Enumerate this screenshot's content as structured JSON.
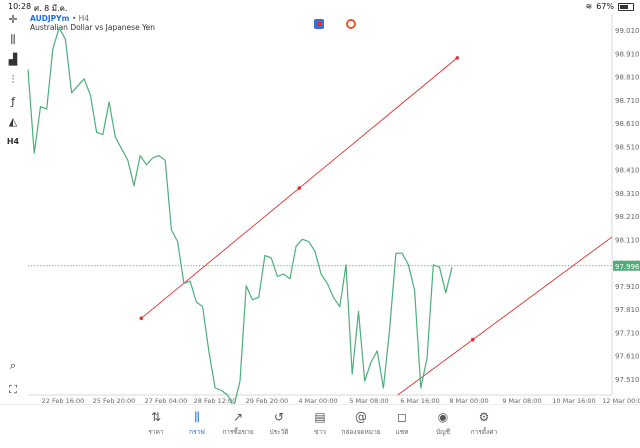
{
  "status_bar": {
    "time": "10:28",
    "date": "ศ. 8 มี.ค.",
    "battery": "67%"
  },
  "symbol": {
    "name": "AUDJPYm",
    "timeframe": "H4",
    "description": "Australian Dollar vs Japanese Yen"
  },
  "left_toolbar": [
    {
      "name": "crosshair-icon",
      "glyph": "✛"
    },
    {
      "name": "candles-icon",
      "glyph": "⫼"
    },
    {
      "name": "volume-icon",
      "glyph": "▟"
    },
    {
      "name": "indicators-icon",
      "glyph": "⫶"
    },
    {
      "name": "function-icon",
      "glyph": "ƒ"
    },
    {
      "name": "shapes-icon",
      "glyph": "◭"
    },
    {
      "name": "timeframe-label",
      "glyph": "H4"
    }
  ],
  "left_toolbar_bottom": [
    {
      "name": "magnifier-icon",
      "glyph": "⌕"
    },
    {
      "name": "one-click-icon",
      "glyph": "⛶"
    }
  ],
  "chart_data": {
    "type": "line",
    "price_labels": [
      "99.010",
      "98.910",
      "98.810",
      "98.710",
      "98.610",
      "98.510",
      "98.410",
      "98.310",
      "98.210",
      "98.110",
      "98.010",
      "97.910",
      "97.810",
      "97.710",
      "97.610",
      "97.510",
      "97.410"
    ],
    "time_labels": [
      "22 Feb 16:00",
      "25 Feb 20:00",
      "27 Feb 04:00",
      "28 Feb 12:00",
      "29 Feb 20:00",
      "4 Mar 00:00",
      "5 Mar 08:00",
      "6 Mar 16:00",
      "8 Mar 00:00",
      "9 Mar 08:00",
      "10 Mar 16:00",
      "12 Mar 00:00"
    ],
    "current_price": "97.996",
    "ylim": [
      97.35,
      99.08
    ],
    "series": [
      {
        "color": "#4caf7a",
        "values": [
          98.84,
          98.48,
          98.68,
          98.67,
          98.93,
          99.02,
          98.97,
          98.74,
          98.77,
          98.8,
          98.73,
          98.57,
          98.56,
          98.7,
          98.55,
          98.5,
          98.45,
          98.34,
          98.47,
          98.43,
          98.46,
          98.47,
          98.45,
          98.15,
          98.1,
          97.92,
          97.93,
          97.84,
          97.82,
          97.63,
          97.47,
          97.46,
          97.44,
          97.39,
          97.5,
          97.91,
          97.85,
          97.86,
          98.04,
          98.03,
          97.95,
          97.96,
          97.94,
          98.08,
          98.11,
          98.1,
          98.06,
          97.96,
          97.92,
          97.86,
          97.82,
          98.0,
          97.53,
          97.8,
          97.5,
          97.58,
          97.63,
          97.47,
          97.72,
          98.05,
          98.05,
          98.0,
          97.89,
          97.47,
          97.6,
          98.0,
          97.99,
          97.88,
          97.99
        ]
      }
    ],
    "trendlines": [
      {
        "color": "#e03030",
        "start": [
          0.194,
          97.77
        ],
        "end": [
          0.735,
          98.89
        ]
      },
      {
        "color": "#e03030",
        "start": [
          0.59,
          97.36
        ],
        "end": [
          1.0,
          98.12
        ]
      }
    ],
    "grid": false
  },
  "bottom_nav": [
    {
      "label": "ราคา",
      "icon": "⇅",
      "name": "nav-quotes",
      "active": false
    },
    {
      "label": "กราฟ",
      "icon": "⫼",
      "name": "nav-chart",
      "active": true
    },
    {
      "label": "การซื้อขาย",
      "icon": "↗",
      "name": "nav-trade",
      "active": false
    },
    {
      "label": "ประวัติ",
      "icon": "↺",
      "name": "nav-history",
      "active": false
    },
    {
      "label": "ข่าว",
      "icon": "▤",
      "name": "nav-news",
      "active": false
    },
    {
      "label": "กล่องจดหมาย",
      "icon": "@",
      "name": "nav-mailbox",
      "active": false
    },
    {
      "label": "แชท",
      "icon": "◻",
      "name": "nav-chat",
      "active": false
    },
    {
      "label": "บัญชี",
      "icon": "◉",
      "name": "nav-accounts",
      "active": false
    },
    {
      "label": "การตั้งค่า",
      "icon": "⚙",
      "name": "nav-settings",
      "active": false
    }
  ]
}
